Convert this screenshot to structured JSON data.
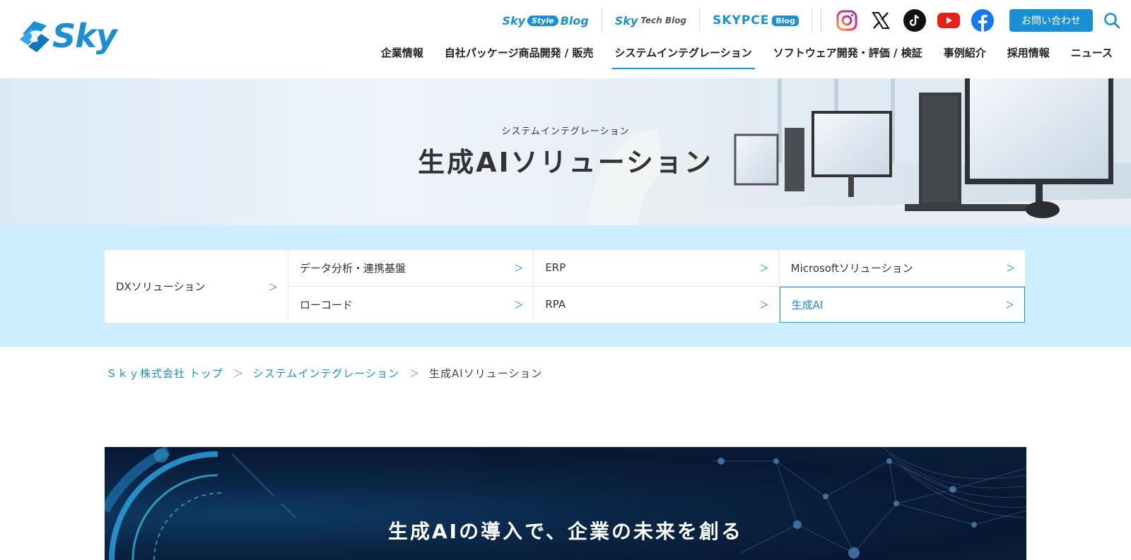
{
  "brand": {
    "logo_text": "Sky"
  },
  "topbar": {
    "blogs": [
      {
        "main": "Sky",
        "pill": "Style",
        "suffix": "Blog"
      },
      {
        "main": "Sky",
        "sub": "Tech Blog"
      },
      {
        "main": "SKYPCE",
        "pill": "Blog"
      }
    ],
    "contact_label": "お問い合わせ"
  },
  "mainnav": [
    "企業情報",
    "自社パッケージ商品開発 / 販売",
    "システムインテグレーション",
    "ソフトウェア開発・評価 / 検証",
    "事例紹介",
    "採用情報",
    "ニュース"
  ],
  "hero": {
    "subtitle": "システムインテグレーション",
    "title": "生成AIソリューション"
  },
  "subnav": {
    "left": "DXソリューション",
    "cells": [
      "データ分析・連携基盤",
      "ERP",
      "Microsoftソリューション",
      "ローコード",
      "RPA",
      "生成AI"
    ],
    "chevron": "＞"
  },
  "breadcrumb": {
    "items": [
      "Ｓｋｙ株式会社 トップ",
      "システムインテグレーション"
    ],
    "current": "生成AIソリューション",
    "separator": "＞"
  },
  "banner": {
    "title": "生成AIの導入で、企業の未来を創る"
  },
  "colors": {
    "accent": "#1a8fd6",
    "subnav_bg": "#cdeefc",
    "banner_bg": "#071833"
  }
}
